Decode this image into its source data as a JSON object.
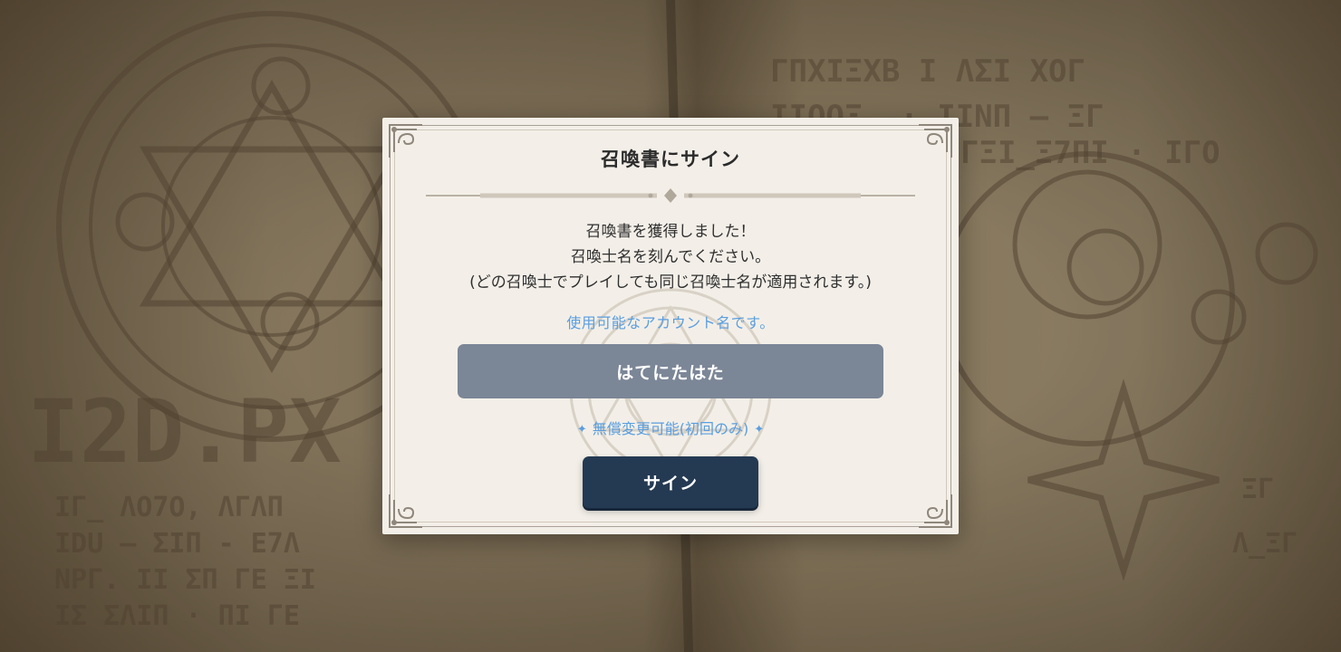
{
  "dialog": {
    "title": "召喚書にサイン",
    "message_lines": [
      "召喚書を獲得しました！",
      "召喚士名を刻んでください。",
      "(どの召喚士でプレイしても同じ召喚士名が適用されます。)"
    ],
    "status": "使用可能なアカウント名です。",
    "name_value": "はてにたはた",
    "note": "無償変更可能(初回のみ)",
    "note_decoration": "✦",
    "sign_label": "サイン"
  },
  "colors": {
    "status_blue": "#5a9ee0",
    "input_bg": "#7b8697",
    "button_bg": "#243a52",
    "dialog_bg": "#f3efe8"
  },
  "icons": {
    "corner": "ornament-corner-icon",
    "divider": "diamond-divider-icon",
    "note_spark": "sparkle-icon"
  }
}
